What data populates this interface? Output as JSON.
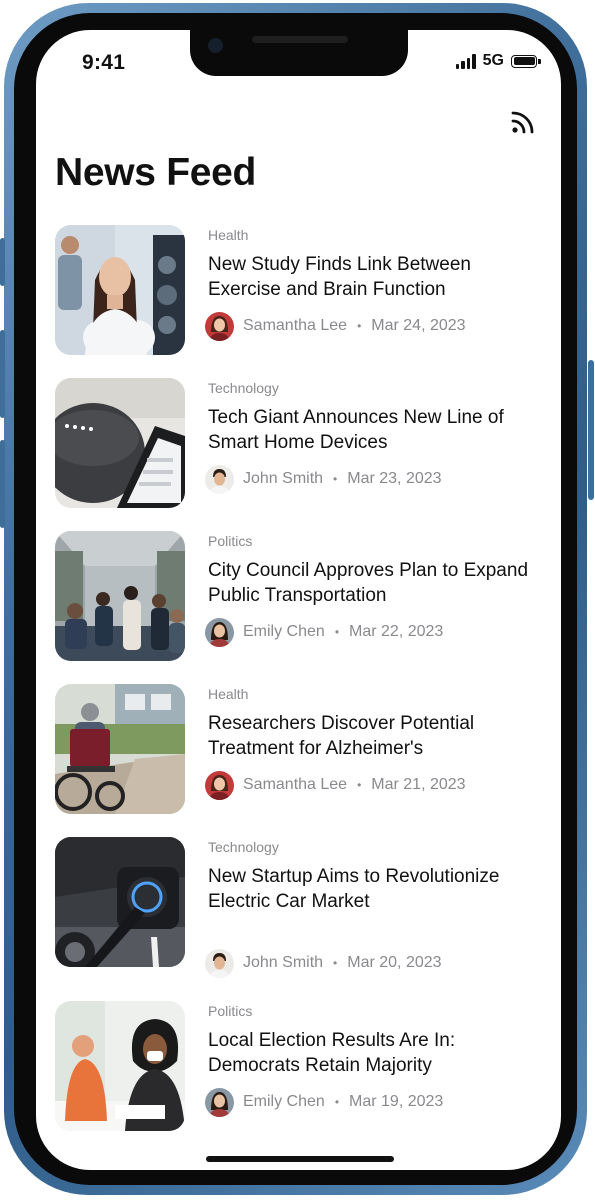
{
  "status_bar": {
    "time": "9:41",
    "network": "5G",
    "signal_icon": "signal-bars-icon",
    "battery_icon": "battery-full-icon"
  },
  "header": {
    "title": "News Feed",
    "action_icon": "rss-feed-icon"
  },
  "colors": {
    "text_primary": "#111111",
    "text_secondary": "#8a8a8e",
    "frame_blue": "#3f6e9a"
  },
  "articles": [
    {
      "category": "Health",
      "title": "New Study Finds Link Between Exercise and Brain Function",
      "author": "Samantha Lee",
      "date": "Mar 24, 2023"
    },
    {
      "category": "Technology",
      "title": "Tech Giant Announces New Line of Smart Home Devices",
      "author": "John Smith",
      "date": "Mar 23, 2023"
    },
    {
      "category": "Politics",
      "title": "City Council Approves Plan to Expand Public Transportation",
      "author": "Emily Chen",
      "date": "Mar 22, 2023"
    },
    {
      "category": "Health",
      "title": "Researchers Discover Potential Treatment for Alzheimer's",
      "author": "Samantha Lee",
      "date": "Mar 21, 2023"
    },
    {
      "category": "Technology",
      "title": "New Startup Aims to Revolutionize Electric Car Market",
      "author": "John Smith",
      "date": "Mar 20, 2023"
    },
    {
      "category": "Politics",
      "title": "Local Election Results Are In: Democrats Retain Majority",
      "author": "Emily Chen",
      "date": "Mar 19, 2023"
    }
  ]
}
